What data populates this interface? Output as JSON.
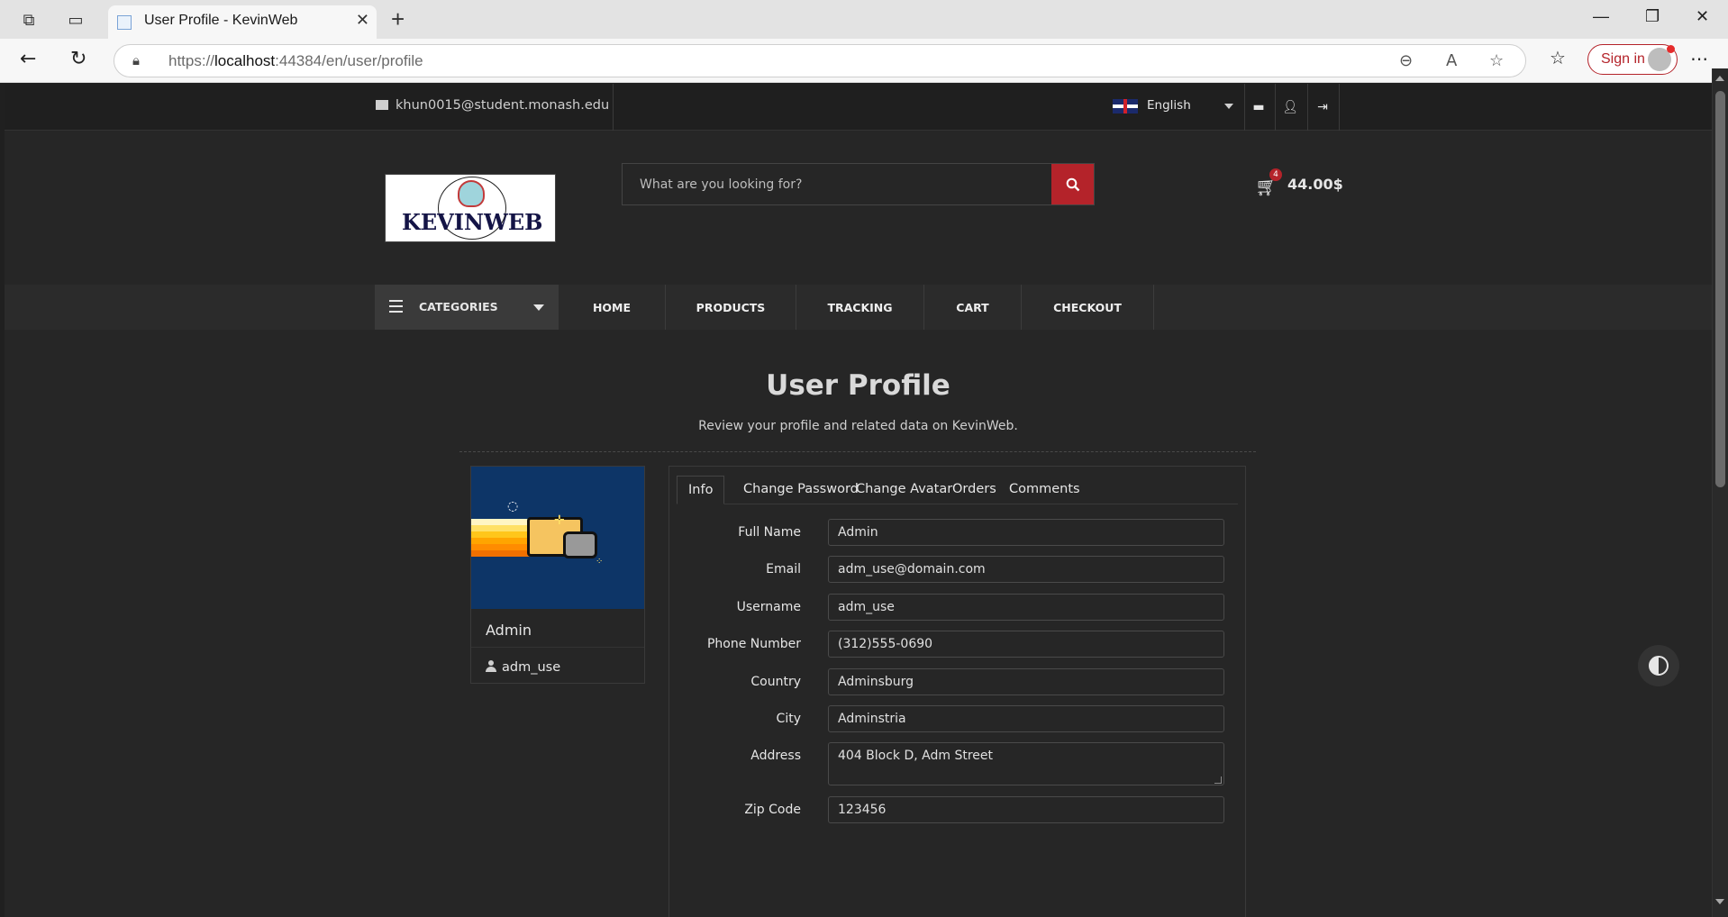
{
  "browser": {
    "tab_title": "User Profile - KevinWeb",
    "url_prefix": "https://",
    "url_host": "localhost",
    "url_rest": ":44384/en/user/profile",
    "signin_label": "Sign in"
  },
  "topbar": {
    "email": "khun0015@student.monash.edu",
    "language": "English"
  },
  "header": {
    "logo_text": "KEVINWEB",
    "search_placeholder": "What are you looking for?",
    "cart_count": "4",
    "cart_total": "44.00$"
  },
  "nav": {
    "categories_label": "CATEGORIES",
    "links": [
      "HOME",
      "PRODUCTS",
      "TRACKING",
      "CART",
      "CHECKOUT"
    ]
  },
  "page": {
    "title": "User Profile",
    "subtitle": "Review your profile and related data on KevinWeb."
  },
  "profile_card": {
    "name": "Admin",
    "username": "adm_use"
  },
  "tabs": [
    "Info",
    "Change Password",
    "Change Avatar",
    "Orders",
    "Comments"
  ],
  "form": {
    "full_name_label": "Full Name",
    "full_name": "Admin",
    "email_label": "Email",
    "email": "adm_use@domain.com",
    "username_label": "Username",
    "username": "adm_use",
    "phone_label": "Phone Number",
    "phone": "(312)555-0690",
    "country_label": "Country",
    "country": "Adminsburg",
    "city_label": "City",
    "city": "Adminstria",
    "address_label": "Address",
    "address": "404 Block D, Adm Street",
    "zip_label": "Zip Code",
    "zip": "123456"
  },
  "colors": {
    "accent": "#b4232a",
    "background": "#262626"
  }
}
